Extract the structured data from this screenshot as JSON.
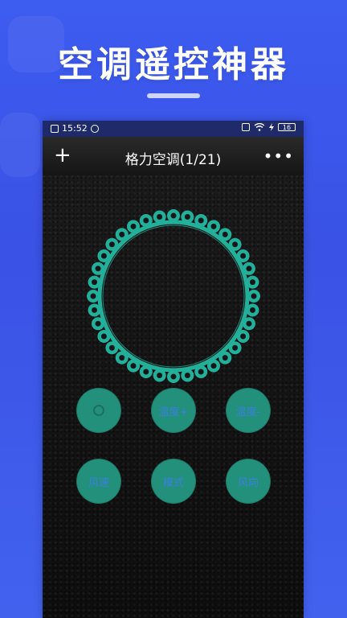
{
  "banner": {
    "headline": "空调遥控神器"
  },
  "statusbar": {
    "time": "15:52",
    "battery": "16"
  },
  "titlebar": {
    "add": "+",
    "title": "格力空调(1/21)",
    "more": "•••"
  },
  "remote": {
    "buttons": {
      "temp_up": "温度+",
      "temp_down": "温度-",
      "fan_speed": "风速",
      "mode": "模式",
      "direction": "风向"
    },
    "ring_color": "#22b09a",
    "button_color": "#22907a",
    "label_color": "#3b7fe0"
  }
}
